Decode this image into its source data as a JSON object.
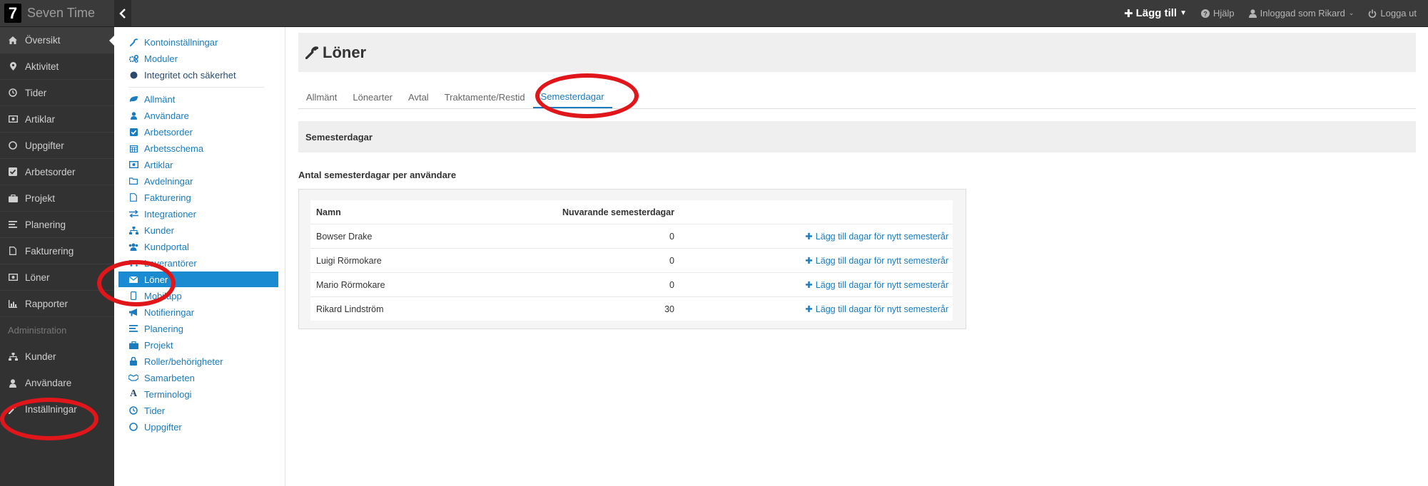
{
  "app": {
    "logo_char": "7",
    "name": "Seven Time"
  },
  "topbar": {
    "add_label": "Lägg till",
    "help_label": "Hjälp",
    "user_label": "Inloggad som Rikard",
    "logout_label": "Logga ut"
  },
  "sidebar": {
    "items": [
      {
        "label": "Översikt",
        "icon": "home-icon"
      },
      {
        "label": "Aktivitet",
        "icon": "map-marker-icon"
      },
      {
        "label": "Tider",
        "icon": "clock-icon"
      },
      {
        "label": "Artiklar",
        "icon": "money-icon"
      },
      {
        "label": "Uppgifter",
        "icon": "circle-icon"
      },
      {
        "label": "Arbetsorder",
        "icon": "check-square-icon"
      },
      {
        "label": "Projekt",
        "icon": "briefcase-icon"
      },
      {
        "label": "Planering",
        "icon": "list-icon"
      },
      {
        "label": "Fakturering",
        "icon": "file-icon"
      },
      {
        "label": "Löner",
        "icon": "money-icon"
      },
      {
        "label": "Rapporter",
        "icon": "bar-chart-icon"
      }
    ],
    "admin_section": "Administration",
    "admin_items": [
      {
        "label": "Kunder",
        "icon": "sitemap-icon"
      },
      {
        "label": "Användare",
        "icon": "user-icon"
      },
      {
        "label": "Inställningar",
        "icon": "wrench-icon"
      }
    ]
  },
  "submenu": {
    "top": [
      {
        "label": "Kontoinställningar"
      },
      {
        "label": "Moduler"
      },
      {
        "label": "Integritet och säkerhet"
      }
    ],
    "items": [
      {
        "label": "Allmänt"
      },
      {
        "label": "Användare"
      },
      {
        "label": "Arbetsorder"
      },
      {
        "label": "Arbetsschema"
      },
      {
        "label": "Artiklar"
      },
      {
        "label": "Avdelningar"
      },
      {
        "label": "Fakturering"
      },
      {
        "label": "Integrationer"
      },
      {
        "label": "Kunder"
      },
      {
        "label": "Kundportal"
      },
      {
        "label": "Leverantörer"
      },
      {
        "label": "Löner"
      },
      {
        "label": "Mobilapp"
      },
      {
        "label": "Notifieringar"
      },
      {
        "label": "Planering"
      },
      {
        "label": "Projekt"
      },
      {
        "label": "Roller/behörigheter"
      },
      {
        "label": "Samarbeten"
      },
      {
        "label": "Terminologi"
      },
      {
        "label": "Tider"
      },
      {
        "label": "Uppgifter"
      }
    ]
  },
  "page": {
    "title": "Löner",
    "tabs": [
      "Allmänt",
      "Lönearter",
      "Avtal",
      "Traktamente/Restid",
      "Semesterdagar"
    ],
    "section_title": "Semesterdagar",
    "subtitle": "Antal semesterdagar per användare",
    "table": {
      "headers": [
        "Namn",
        "Nuvarande semesterdagar"
      ],
      "action_label": "Lägg till dagar för nytt semesterår",
      "rows": [
        {
          "name": "Bowser Drake",
          "days": "0"
        },
        {
          "name": "Luigi Rörmokare",
          "days": "0"
        },
        {
          "name": "Mario Rörmokare",
          "days": "0"
        },
        {
          "name": "Rikard Lindström",
          "days": "30"
        }
      ]
    }
  },
  "colors": {
    "accent": "#1a7bbf",
    "active_menu": "#1a8bd0",
    "annotation": "#e0161b",
    "topbar": "#3a3a3a",
    "sidebar": "#323232"
  }
}
